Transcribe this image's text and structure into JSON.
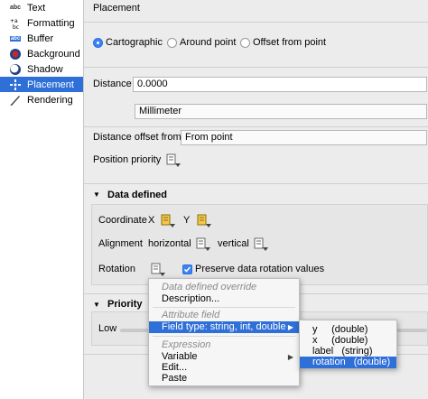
{
  "sidebar": {
    "items": [
      {
        "label": "Text",
        "icon": "text-abc-icon",
        "selected": false
      },
      {
        "label": "Formatting",
        "icon": "formatting-icon",
        "selected": false
      },
      {
        "label": "Buffer",
        "icon": "buffer-icon",
        "selected": false
      },
      {
        "label": "Background",
        "icon": "background-icon",
        "selected": false
      },
      {
        "label": "Shadow",
        "icon": "shadow-icon",
        "selected": false
      },
      {
        "label": "Placement",
        "icon": "placement-icon",
        "selected": true
      },
      {
        "label": "Rendering",
        "icon": "rendering-icon",
        "selected": false
      }
    ],
    "icon_glyphs": {
      "text": "abc",
      "buffer": "abc"
    }
  },
  "placement": {
    "title": "Placement",
    "modes": [
      {
        "label": "Cartographic",
        "selected": true
      },
      {
        "label": "Around point",
        "selected": false
      },
      {
        "label": "Offset from point",
        "selected": false
      }
    ],
    "distance_label": "Distance",
    "distance_value": "0.0000",
    "unit_value": "Millimeter",
    "offset_from_label": "Distance offset from",
    "offset_from_value": "From point",
    "priority_label": "Position priority"
  },
  "data_defined": {
    "title": "Data defined",
    "coordinate_label": "Coordinate",
    "x_label": "X",
    "y_label": "Y",
    "alignment_label": "Alignment",
    "horizontal_label": "horizontal",
    "vertical_label": "vertical",
    "rotation_label": "Rotation",
    "preserve_label": "Preserve data rotation values",
    "preserve_checked": true
  },
  "priority": {
    "title": "Priority",
    "low_label": "Low"
  },
  "context_menu": {
    "header_override": "Data defined override",
    "description": "Description...",
    "header_field": "Attribute field",
    "field_type": "Field type: string, int, double",
    "header_expression": "Expression",
    "variable": "Variable",
    "edit": "Edit...",
    "paste": "Paste"
  },
  "submenu": {
    "fields": [
      {
        "name": "y",
        "type": "(double)"
      },
      {
        "name": "x",
        "type": "(double)"
      },
      {
        "name": "label",
        "type": "(string)"
      },
      {
        "name": "rotation",
        "type": "(double)"
      }
    ],
    "highlighted_index": 3
  },
  "colors": {
    "selection": "#2f6fd8",
    "icon_yellow": "#f2c94c"
  }
}
